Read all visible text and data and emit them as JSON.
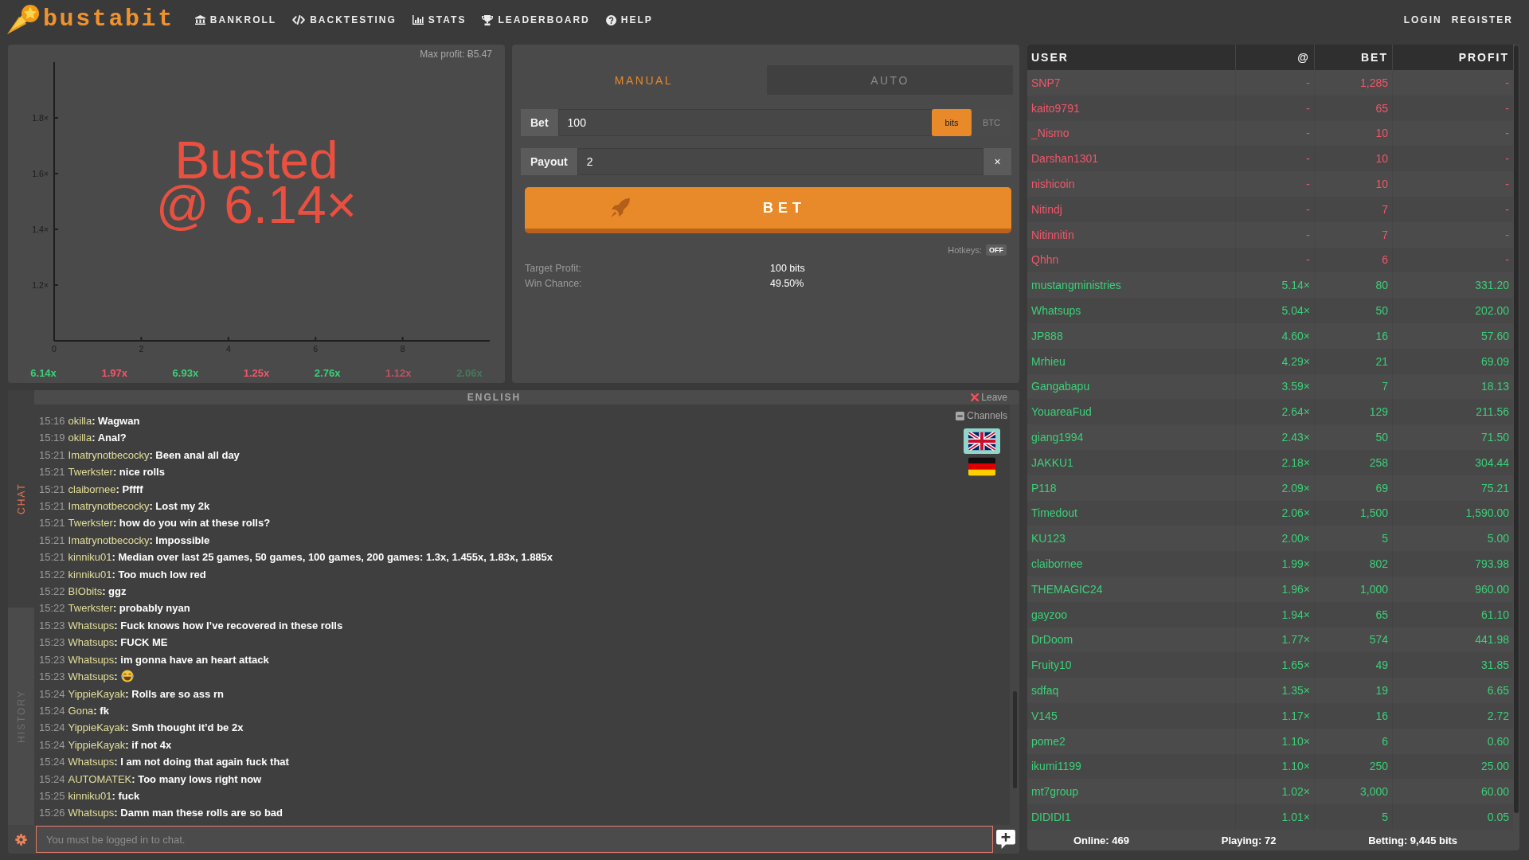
{
  "header": {
    "brand": "bustabit",
    "nav": [
      {
        "label": "BANKROLL",
        "kind": "bankroll"
      },
      {
        "label": "BACKTESTING",
        "kind": "backtesting"
      },
      {
        "label": "STATS",
        "kind": "stats"
      },
      {
        "label": "LEADERBOARD",
        "kind": "leaderboard"
      },
      {
        "label": "HELP",
        "kind": "help"
      }
    ],
    "account": [
      "LOGIN",
      "REGISTER"
    ]
  },
  "game": {
    "max_profit": "Max profit: Ƀ5.47",
    "status": "Busted",
    "crash_point": "@ 6.14×",
    "chart_data": {
      "type": "line",
      "xlim": [
        0,
        10
      ],
      "ylim": [
        1,
        2
      ],
      "xticks": [
        0,
        2,
        4,
        6,
        8
      ],
      "yticks": [
        {
          "value": 1.2,
          "label": "1.2×"
        },
        {
          "value": 1.4,
          "label": "1.4×"
        },
        {
          "value": 1.6,
          "label": "1.6×"
        },
        {
          "value": 1.8,
          "label": "1.8×"
        }
      ]
    },
    "history": [
      {
        "value": "6.14x",
        "kind": "high"
      },
      {
        "value": "1.97x",
        "kind": "low"
      },
      {
        "value": "6.93x",
        "kind": "high"
      },
      {
        "value": "1.25x",
        "kind": "low"
      },
      {
        "value": "2.76x",
        "kind": "high"
      },
      {
        "value": "1.12x",
        "kind": "low"
      },
      {
        "value": "2.06x",
        "kind": "high"
      }
    ]
  },
  "bet_panel": {
    "tabs": [
      {
        "label": "MANUAL",
        "selected": true
      },
      {
        "label": "AUTO",
        "selected": false
      }
    ],
    "bet": {
      "label": "Bet",
      "value": "100",
      "units": [
        {
          "label": "bits",
          "selected": true
        },
        {
          "label": "BTC",
          "selected": false
        }
      ]
    },
    "payout": {
      "label": "Payout",
      "value": "2",
      "clear": "×"
    },
    "bet_button": "BET",
    "hotkeys": {
      "label": "Hotkeys:",
      "value": "OFF",
      "on": false
    },
    "summary": [
      {
        "label": "Target Profit:",
        "value": "100 bits"
      },
      {
        "label": "Win Chance:",
        "value": "49.50%"
      }
    ]
  },
  "chat": {
    "tabs": [
      {
        "label": "CHAT",
        "selected": true
      },
      {
        "label": "HISTORY",
        "selected": false
      }
    ],
    "channel": "ENGLISH",
    "leave": "Leave",
    "channels_label": "Channels",
    "channels": [
      {
        "kind": "uk",
        "selected": true
      },
      {
        "kind": "de",
        "selected": false
      }
    ],
    "messages": [
      {
        "time": "15:16",
        "user": "okilla",
        "text": ": Wagwan",
        "kind": "text"
      },
      {
        "time": "15:19",
        "user": "okilla",
        "text": ": Anal?",
        "kind": "text"
      },
      {
        "time": "15:21",
        "user": "Imatrynotbecocky",
        "text": ": Been anal all day",
        "kind": "text"
      },
      {
        "time": "15:21",
        "user": "Twerkster",
        "text": ": nice rolls",
        "kind": "text"
      },
      {
        "time": "15:21",
        "user": "claibornee",
        "text": ": Pffff",
        "kind": "text"
      },
      {
        "time": "15:21",
        "user": "Imatrynotbecocky",
        "text": ": Lost my 2k",
        "kind": "text"
      },
      {
        "time": "15:21",
        "user": "Twerkster",
        "text": ": how do you win at these rolls?",
        "kind": "text"
      },
      {
        "time": "15:21",
        "user": "Imatrynotbecocky",
        "text": ": Impossible",
        "kind": "text"
      },
      {
        "time": "15:21",
        "user": "kinniku01",
        "text": ": Median over last 25 games, 50 games, 100 games, 200 games: 1.3x, 1.455x, 1.83x, 1.885x",
        "kind": "text"
      },
      {
        "time": "15:22",
        "user": "kinniku01",
        "text": ": Too much low red",
        "kind": "text"
      },
      {
        "time": "15:22",
        "user": "BIObits",
        "text": ": ggz",
        "kind": "text"
      },
      {
        "time": "15:22",
        "user": "Twerkster",
        "text": ": probably nyan",
        "kind": "text"
      },
      {
        "time": "15:23",
        "user": "Whatsups",
        "text": ": Fuck knows how I’ve recovered in these rolls",
        "kind": "text"
      },
      {
        "time": "15:23",
        "user": "Whatsups",
        "text": ": FUCK ME",
        "kind": "text"
      },
      {
        "time": "15:23",
        "user": "Whatsups",
        "text": ": im gonna have an heart attack",
        "kind": "text"
      },
      {
        "time": "15:23",
        "user": "Whatsups",
        "text": ":",
        "kind": "emoji"
      },
      {
        "time": "15:24",
        "user": "YippieKayak",
        "text": ": Rolls are so ass rn",
        "kind": "text"
      },
      {
        "time": "15:24",
        "user": "Gona",
        "text": ": fk",
        "kind": "text"
      },
      {
        "time": "15:24",
        "user": "YippieKayak",
        "text": ": Smh thought it’d be 2x",
        "kind": "text"
      },
      {
        "time": "15:24",
        "user": "YippieKayak",
        "text": ": if not 4x",
        "kind": "text"
      },
      {
        "time": "15:24",
        "user": "Whatsups",
        "text": ": I am not doing that again fuck that",
        "kind": "text"
      },
      {
        "time": "15:24",
        "user": "AUTOMATEK",
        "text": ": Too many lows right now",
        "kind": "text"
      },
      {
        "time": "15:25",
        "user": "kinniku01",
        "text": ": fuck",
        "kind": "text"
      },
      {
        "time": "15:26",
        "user": "Whatsups",
        "text": ": Damn man these rolls are so bad",
        "kind": "text"
      }
    ],
    "input": {
      "placeholder": "You must be logged in to chat."
    }
  },
  "players": {
    "columns": [
      "USER",
      "@",
      "BET",
      "PROFIT"
    ],
    "rows": [
      {
        "user": "SNP7",
        "at": "-",
        "bet": "1,285",
        "profit": "-",
        "won": false
      },
      {
        "user": "kaito9791",
        "at": "-",
        "bet": "65",
        "profit": "-",
        "won": false
      },
      {
        "user": "_Nismo",
        "at": "-",
        "bet": "10",
        "profit": "-",
        "won": false
      },
      {
        "user": "Darshan1301",
        "at": "-",
        "bet": "10",
        "profit": "-",
        "won": false
      },
      {
        "user": "nishicoin",
        "at": "-",
        "bet": "10",
        "profit": "-",
        "won": false
      },
      {
        "user": "Nitindj",
        "at": "-",
        "bet": "7",
        "profit": "-",
        "won": false
      },
      {
        "user": "Nitinnitin",
        "at": "-",
        "bet": "7",
        "profit": "-",
        "won": false
      },
      {
        "user": "Qhhn",
        "at": "-",
        "bet": "6",
        "profit": "-",
        "won": false
      },
      {
        "user": "mustangministries",
        "at": "5.14×",
        "bet": "80",
        "profit": "331.20",
        "won": true
      },
      {
        "user": "Whatsups",
        "at": "5.04×",
        "bet": "50",
        "profit": "202.00",
        "won": true
      },
      {
        "user": "JP888",
        "at": "4.60×",
        "bet": "16",
        "profit": "57.60",
        "won": true
      },
      {
        "user": "Mrhieu",
        "at": "4.29×",
        "bet": "21",
        "profit": "69.09",
        "won": true
      },
      {
        "user": "Gangabapu",
        "at": "3.59×",
        "bet": "7",
        "profit": "18.13",
        "won": true
      },
      {
        "user": "YouareaFud",
        "at": "2.64×",
        "bet": "129",
        "profit": "211.56",
        "won": true
      },
      {
        "user": "giang1994",
        "at": "2.43×",
        "bet": "50",
        "profit": "71.50",
        "won": true
      },
      {
        "user": "JAKKU1",
        "at": "2.18×",
        "bet": "258",
        "profit": "304.44",
        "won": true
      },
      {
        "user": "P118",
        "at": "2.09×",
        "bet": "69",
        "profit": "75.21",
        "won": true
      },
      {
        "user": "Timedout",
        "at": "2.06×",
        "bet": "1,500",
        "profit": "1,590.00",
        "won": true
      },
      {
        "user": "KU123",
        "at": "2.00×",
        "bet": "5",
        "profit": "5.00",
        "won": true
      },
      {
        "user": "claibornee",
        "at": "1.99×",
        "bet": "802",
        "profit": "793.98",
        "won": true
      },
      {
        "user": "THEMAGIC24",
        "at": "1.96×",
        "bet": "1,000",
        "profit": "960.00",
        "won": true
      },
      {
        "user": "gayzoo",
        "at": "1.94×",
        "bet": "65",
        "profit": "61.10",
        "won": true
      },
      {
        "user": "DrDoom",
        "at": "1.77×",
        "bet": "574",
        "profit": "441.98",
        "won": true
      },
      {
        "user": "Fruity10",
        "at": "1.65×",
        "bet": "49",
        "profit": "31.85",
        "won": true
      },
      {
        "user": "sdfaq",
        "at": "1.35×",
        "bet": "19",
        "profit": "6.65",
        "won": true
      },
      {
        "user": "V145",
        "at": "1.17×",
        "bet": "16",
        "profit": "2.72",
        "won": true
      },
      {
        "user": "pome2",
        "at": "1.10×",
        "bet": "6",
        "profit": "0.60",
        "won": true
      },
      {
        "user": "ikumi1199",
        "at": "1.10×",
        "bet": "250",
        "profit": "25.00",
        "won": true
      },
      {
        "user": "mt7group",
        "at": "1.02×",
        "bet": "3,000",
        "profit": "60.00",
        "won": true
      },
      {
        "user": "DIDIDI1",
        "at": "1.01×",
        "bet": "5",
        "profit": "0.05",
        "won": true
      }
    ],
    "footer": [
      "Online: 469",
      "Playing: 72",
      "Betting: 9,445 bits"
    ]
  }
}
